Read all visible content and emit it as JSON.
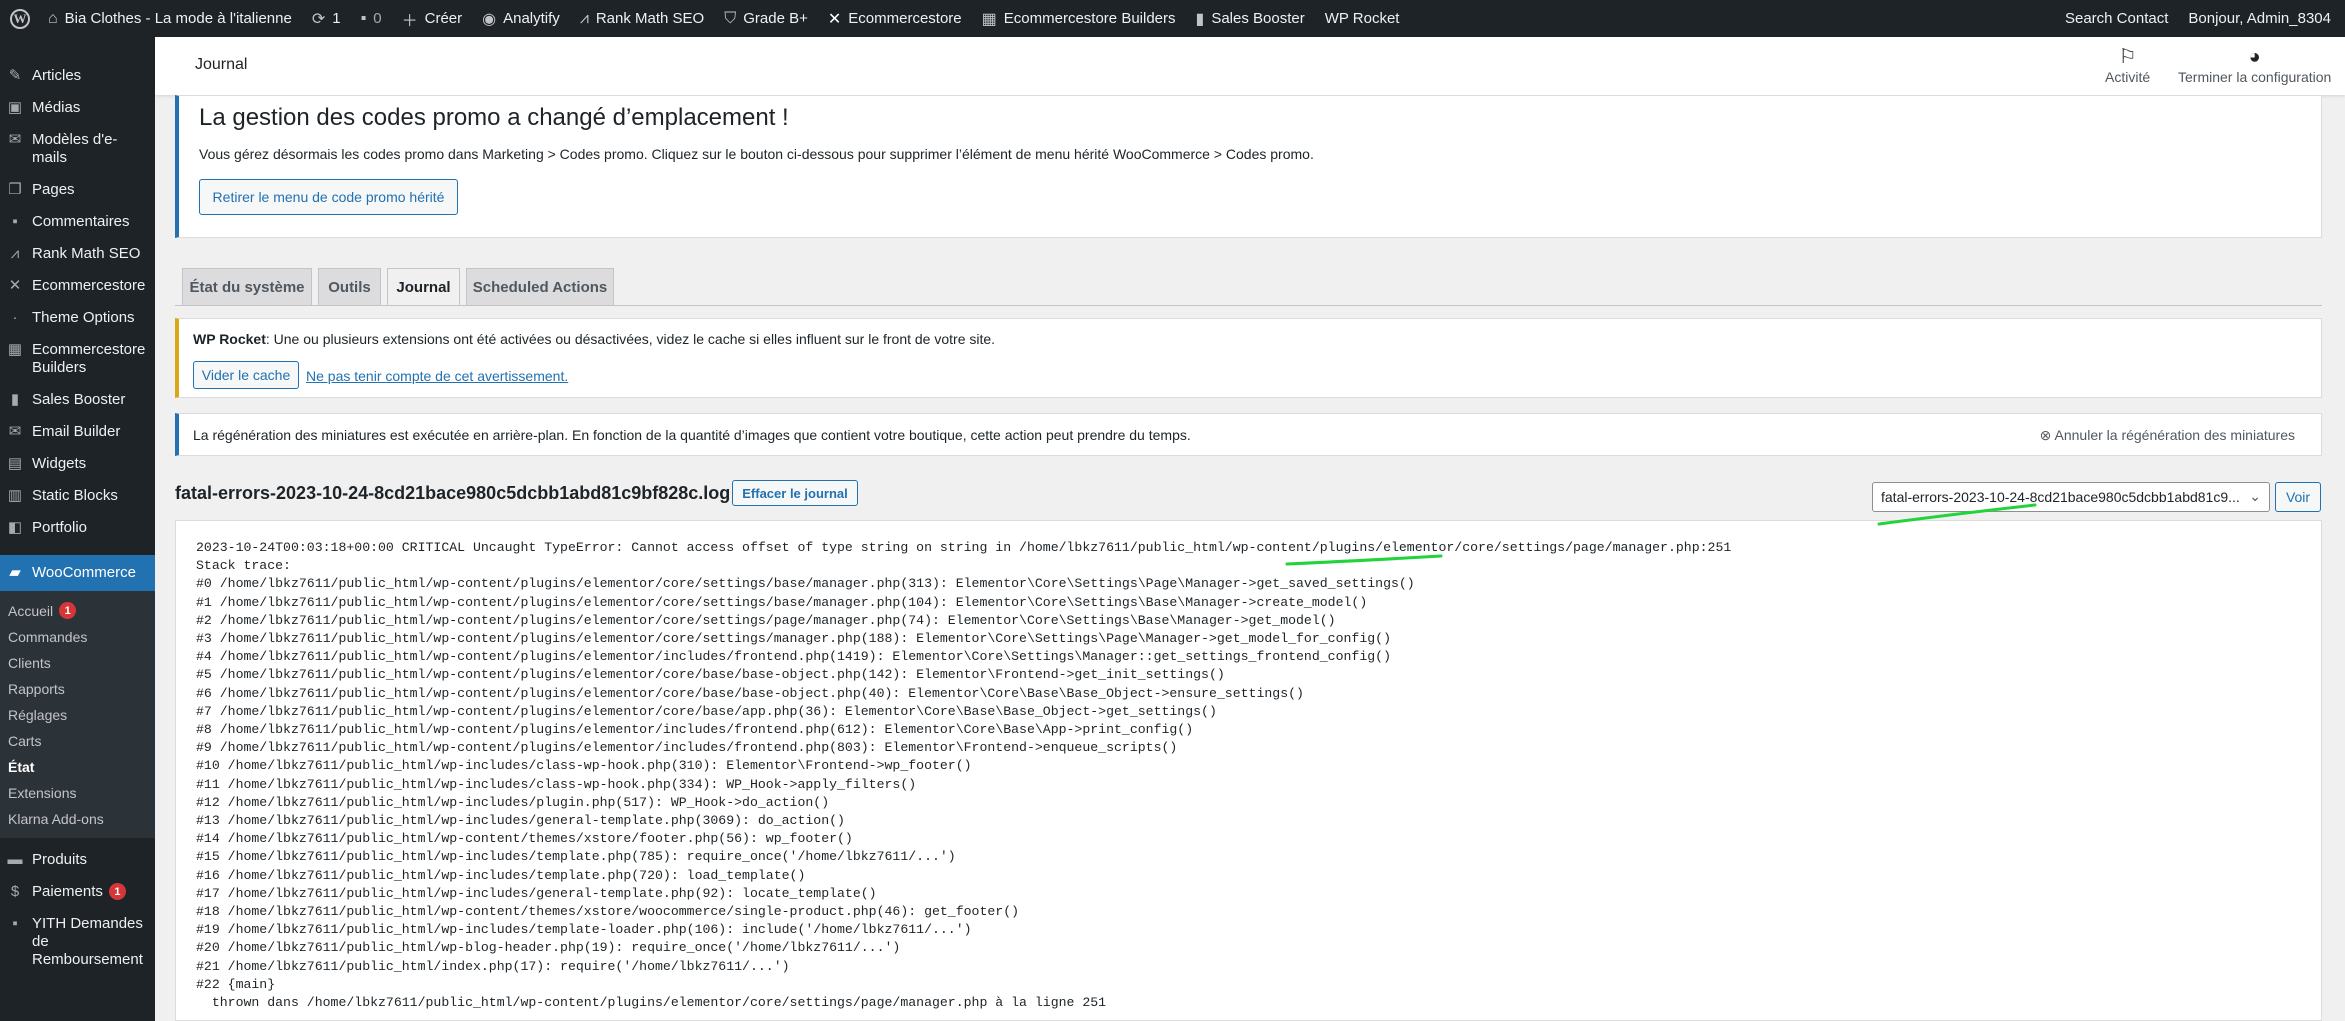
{
  "adminbar": {
    "site_name": "Bia Clothes - La mode à l'italienne",
    "updates_count": "1",
    "comments_count": "0",
    "new_label": "Créer",
    "items": [
      "Analytify",
      "Rank Math SEO",
      "Grade B+",
      "Ecommercestore",
      "Ecommercestore Builders",
      "Sales Booster",
      "WP Rocket"
    ],
    "search_contact": "Search Contact",
    "greeting": "Bonjour, Admin_8304"
  },
  "sidebar": {
    "top_items": [
      "Articles",
      "Médias",
      "Modèles d'e-mails",
      "Pages",
      "Commentaires",
      "Rank Math SEO",
      "Ecommercestore",
      "Theme Options",
      "Ecommercestore Builders",
      "Sales Booster",
      "Email Builder",
      "Widgets",
      "Static Blocks",
      "Portfolio"
    ],
    "active_item": "WooCommerce",
    "sub_items": [
      "Accueil",
      "Commandes",
      "Clients",
      "Rapports",
      "Réglages",
      "Carts",
      "État",
      "Extensions",
      "Klarna Add-ons"
    ],
    "accueil_badge": "1",
    "current_sub": "État",
    "bottom_items": [
      "Produits",
      "Paiements",
      "YITH Demandes de Remboursement"
    ],
    "paiements_badge": "1"
  },
  "header": {
    "title": "Journal",
    "activity_label": "Activité",
    "finish_setup_label": "Terminer la configuration"
  },
  "coupon_notice": {
    "title": "La gestion des codes promo a changé d’emplacement !",
    "text": "Vous gérez désormais les codes promo dans Marketing > Codes promo. Cliquez sur le bouton ci-dessous pour supprimer l’élément de menu hérité WooCommerce > Codes promo.",
    "button": "Retirer le menu de code promo hérité"
  },
  "tabs": [
    "État du système",
    "Outils",
    "Journal",
    "Scheduled Actions"
  ],
  "active_tab": "Journal",
  "rocket_notice": {
    "strong": "WP Rocket",
    "text": ": Une ou plusieurs extensions ont été activées ou désactivées, videz le cache si elles influent sur le front de votre site.",
    "clear_button": "Vider le cache",
    "dismiss_link": "Ne pas tenir compte de cet avertissement."
  },
  "regen_notice": {
    "text": "La régénération des miniatures est exécutée en arrière-plan. En fonction de la quantité d’images que contient votre boutique, cette action peut prendre du temps.",
    "cancel": "Annuler la régénération des miniatures"
  },
  "log": {
    "filename": "fatal-errors-2023-10-24-8cd21bace980c5dcbb1abd81c9bf828c.log",
    "clear_button": "Effacer le journal",
    "select_value": "fatal-errors-2023-10-24-8cd21bace980c5dcbb1abd81c9...",
    "view_button": "Voir",
    "lines": [
      "2023-10-24T00:03:18+00:00 CRITICAL Uncaught TypeError: Cannot access offset of type string on string in /home/lbkz7611/public_html/wp-content/plugins/elementor/core/settings/page/manager.php:251",
      "Stack trace:",
      "#0 /home/lbkz7611/public_html/wp-content/plugins/elementor/core/settings/base/manager.php(313): Elementor\\Core\\Settings\\Page\\Manager->get_saved_settings()",
      "#1 /home/lbkz7611/public_html/wp-content/plugins/elementor/core/settings/base/manager.php(104): Elementor\\Core\\Settings\\Base\\Manager->create_model()",
      "#2 /home/lbkz7611/public_html/wp-content/plugins/elementor/core/settings/page/manager.php(74): Elementor\\Core\\Settings\\Base\\Manager->get_model()",
      "#3 /home/lbkz7611/public_html/wp-content/plugins/elementor/core/settings/manager.php(188): Elementor\\Core\\Settings\\Page\\Manager->get_model_for_config()",
      "#4 /home/lbkz7611/public_html/wp-content/plugins/elementor/includes/frontend.php(1419): Elementor\\Core\\Settings\\Manager::get_settings_frontend_config()",
      "#5 /home/lbkz7611/public_html/wp-content/plugins/elementor/core/base/base-object.php(142): Elementor\\Frontend->get_init_settings()",
      "#6 /home/lbkz7611/public_html/wp-content/plugins/elementor/core/base/base-object.php(40): Elementor\\Core\\Base\\Base_Object->ensure_settings()",
      "#7 /home/lbkz7611/public_html/wp-content/plugins/elementor/core/base/app.php(36): Elementor\\Core\\Base\\Base_Object->get_settings()",
      "#8 /home/lbkz7611/public_html/wp-content/plugins/elementor/includes/frontend.php(612): Elementor\\Core\\Base\\App->print_config()",
      "#9 /home/lbkz7611/public_html/wp-content/plugins/elementor/includes/frontend.php(803): Elementor\\Frontend->enqueue_scripts()",
      "#10 /home/lbkz7611/public_html/wp-includes/class-wp-hook.php(310): Elementor\\Frontend->wp_footer()",
      "#11 /home/lbkz7611/public_html/wp-includes/class-wp-hook.php(334): WP_Hook->apply_filters()",
      "#12 /home/lbkz7611/public_html/wp-includes/plugin.php(517): WP_Hook->do_action()",
      "#13 /home/lbkz7611/public_html/wp-includes/general-template.php(3069): do_action()",
      "#14 /home/lbkz7611/public_html/wp-content/themes/xstore/footer.php(56): wp_footer()",
      "#15 /home/lbkz7611/public_html/wp-includes/template.php(785): require_once('/home/lbkz7611/...')",
      "#16 /home/lbkz7611/public_html/wp-includes/template.php(720): load_template()",
      "#17 /home/lbkz7611/public_html/wp-includes/general-template.php(92): locate_template()",
      "#18 /home/lbkz7611/public_html/wp-content/themes/xstore/woocommerce/single-product.php(46): get_footer()",
      "#19 /home/lbkz7611/public_html/wp-includes/template-loader.php(106): include('/home/lbkz7611/...')",
      "#20 /home/lbkz7611/public_html/wp-blog-header.php(19): require_once('/home/lbkz7611/...')",
      "#21 /home/lbkz7611/public_html/index.php(17): require('/home/lbkz7611/...')",
      "#22 {main}",
      "  thrown dans /home/lbkz7611/public_html/wp-content/plugins/elementor/core/settings/page/manager.php à la ligne 251"
    ]
  },
  "colors": {
    "admin_dark": "#1d2327",
    "wp_blue": "#2271b1",
    "warning": "#dba617",
    "highlight_green": "#22d33a"
  }
}
